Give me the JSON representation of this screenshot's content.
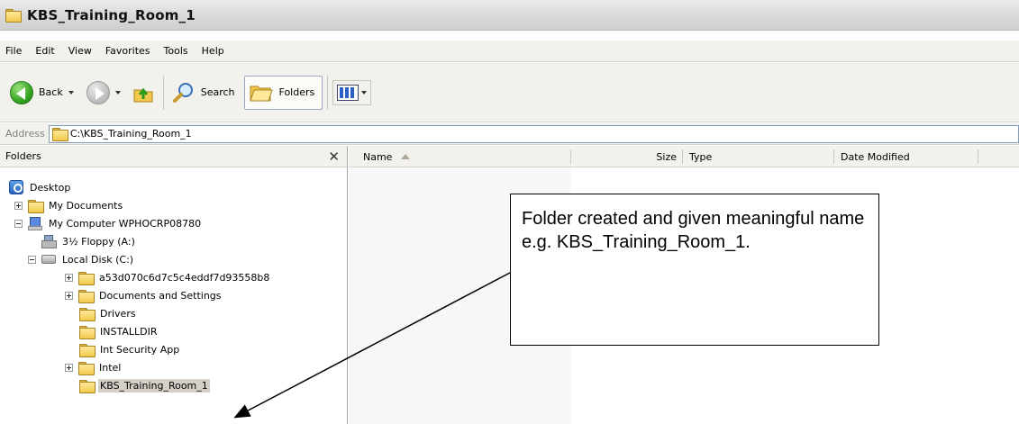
{
  "window": {
    "title": "KBS_Training_Room_1"
  },
  "menu": [
    "File",
    "Edit",
    "View",
    "Favorites",
    "Tools",
    "Help"
  ],
  "toolbar": {
    "back_label": "Back",
    "search_label": "Search",
    "folders_label": "Folders"
  },
  "address": {
    "label": "Address",
    "value": "C:\\KBS_Training_Room_1"
  },
  "folders_pane": {
    "title": "Folders",
    "tree": [
      {
        "label": "Desktop",
        "icon": "desktop-icon"
      },
      {
        "label": "My Documents",
        "icon": "folder-icon"
      },
      {
        "label": "My Computer WPHOCRP08780",
        "icon": "computer-icon"
      },
      {
        "label": "3½ Floppy (A:)",
        "icon": "floppy-icon"
      },
      {
        "label": "Local Disk (C:)",
        "icon": "disk-icon"
      },
      {
        "label": "a53d070c6d7c5c4eddf7d93558b8",
        "icon": "folder-icon"
      },
      {
        "label": "Documents and Settings",
        "icon": "folder-icon"
      },
      {
        "label": "Drivers",
        "icon": "folder-icon"
      },
      {
        "label": "INSTALLDIR",
        "icon": "folder-icon"
      },
      {
        "label": "Int Security App",
        "icon": "folder-icon"
      },
      {
        "label": "Intel",
        "icon": "folder-icon"
      },
      {
        "label": "KBS_Training_Room_1",
        "icon": "folder-icon",
        "selected": true
      }
    ]
  },
  "columns": [
    "Name",
    "Size",
    "Type",
    "Date Modified"
  ],
  "callout": {
    "text": "Folder created and given meaningful name e.g. KBS_Training_Room_1."
  }
}
